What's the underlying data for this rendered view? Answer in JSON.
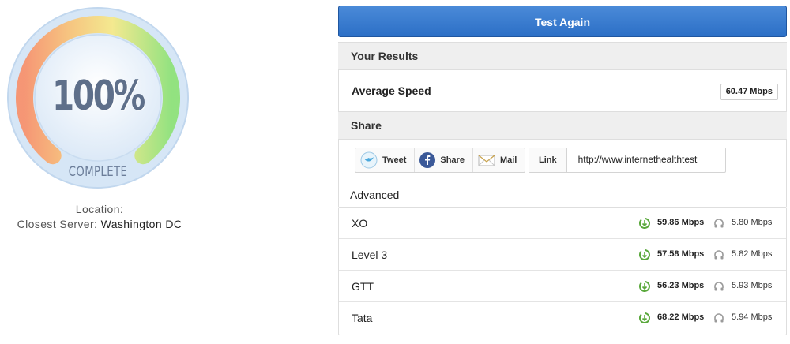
{
  "gauge": {
    "percent_label": "100%",
    "status_label": "COMPLETE",
    "progress": 1.0,
    "colors": {
      "start": "#f7926e",
      "middle": "#f5e98a",
      "end": "#8fe27a",
      "ring": "#cfe3f5"
    }
  },
  "location": {
    "label": "Location:",
    "server_label": "Closest Server:",
    "server_name": "Washington DC"
  },
  "actions": {
    "test_again": "Test Again"
  },
  "results": {
    "title": "Your Results",
    "average_label": "Average Speed",
    "average_value": "60.47 Mbps"
  },
  "share": {
    "title": "Share",
    "buttons": [
      {
        "label": "Tweet",
        "icon": "twitter-icon"
      },
      {
        "label": "Share",
        "icon": "facebook-icon"
      },
      {
        "label": "Mail",
        "icon": "mail-icon"
      }
    ],
    "link_label": "Link",
    "link_value": "http://www.internethealthtest"
  },
  "advanced": {
    "title": "Advanced",
    "rows": [
      {
        "name": "XO",
        "download": "59.86 Mbps",
        "upload": "5.80 Mbps"
      },
      {
        "name": "Level 3",
        "download": "57.58 Mbps",
        "upload": "5.82 Mbps"
      },
      {
        "name": "GTT",
        "download": "56.23 Mbps",
        "upload": "5.93 Mbps"
      },
      {
        "name": "Tata",
        "download": "68.22 Mbps",
        "upload": "5.94 Mbps"
      }
    ],
    "download_icon": "download-arrow-icon",
    "upload_icon": "upload-headphone-icon",
    "colors": {
      "download": "#5aa83c",
      "upload": "#9a9a9a"
    }
  }
}
